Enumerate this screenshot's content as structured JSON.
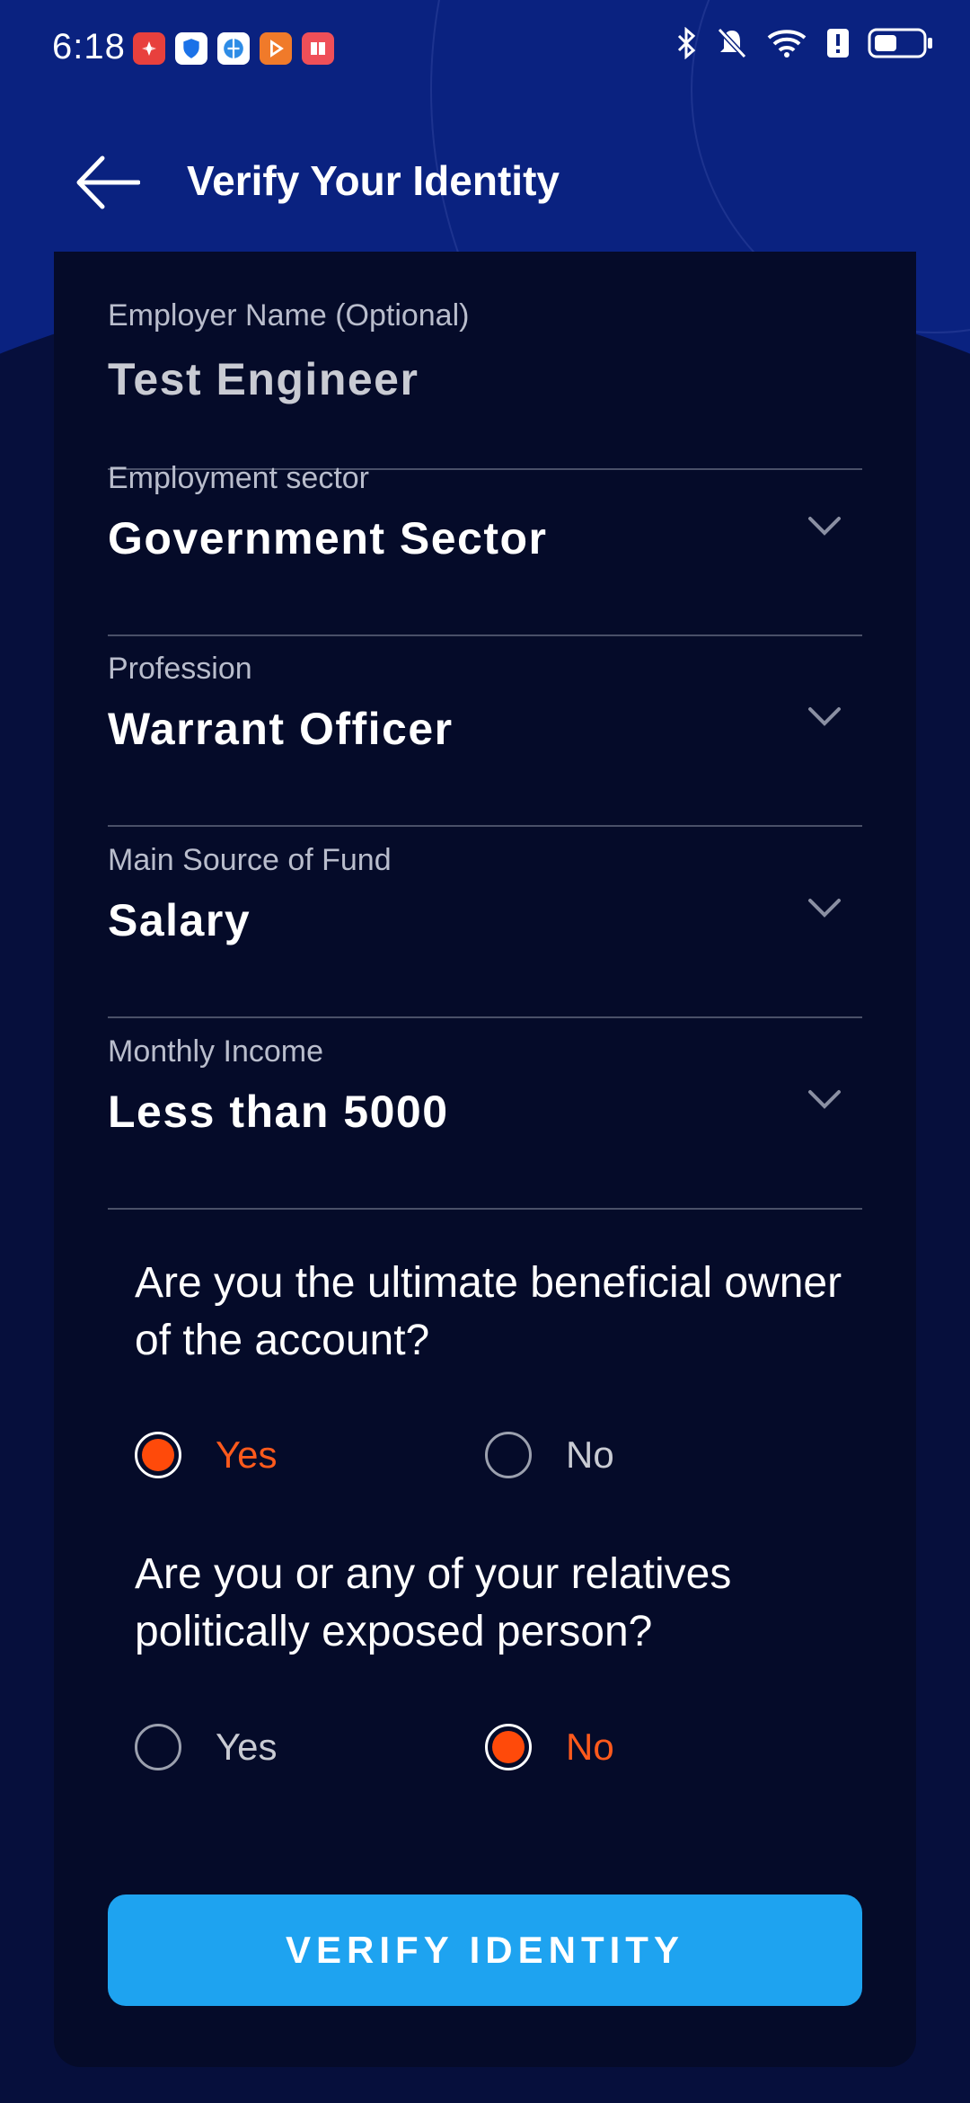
{
  "status_bar": {
    "time": "6:18",
    "notification_icons": [
      "huawei-icon",
      "shield-icon",
      "browser-icon",
      "play-icon",
      "book-icon"
    ],
    "system_icons": [
      "bluetooth-icon",
      "mute-icon",
      "wifi-icon",
      "alert-icon",
      "battery-icon"
    ]
  },
  "header": {
    "title": "Verify Your Identity",
    "back_icon": "arrow-left-icon"
  },
  "fields": {
    "employer": {
      "label": "Employer Name (Optional)",
      "value": "Test Engineer"
    },
    "sector": {
      "label": "Employment sector",
      "value": "Government Sector"
    },
    "profession": {
      "label": "Profession",
      "value": "Warrant Officer"
    },
    "fund": {
      "label": "Main Source of Fund",
      "value": "Salary"
    },
    "income": {
      "label": "Monthly Income",
      "value": "Less than 5000"
    }
  },
  "questions": {
    "beneficial_owner": {
      "text": "Are you the ultimate beneficial owner of the account?",
      "yes_label": "Yes",
      "no_label": "No",
      "selected": "Yes"
    },
    "pep": {
      "text": "Are you or any of your relatives politically exposed person?",
      "yes_label": "Yes",
      "no_label": "No",
      "selected": "No"
    }
  },
  "cta_label": "VERIFY IDENTITY",
  "colors": {
    "hero_bg": "#0a2280",
    "page_bg": "#060f3c",
    "card_bg": "#050b29",
    "accent_orange": "#ff4a0a",
    "button_blue": "#1ea3f0"
  }
}
